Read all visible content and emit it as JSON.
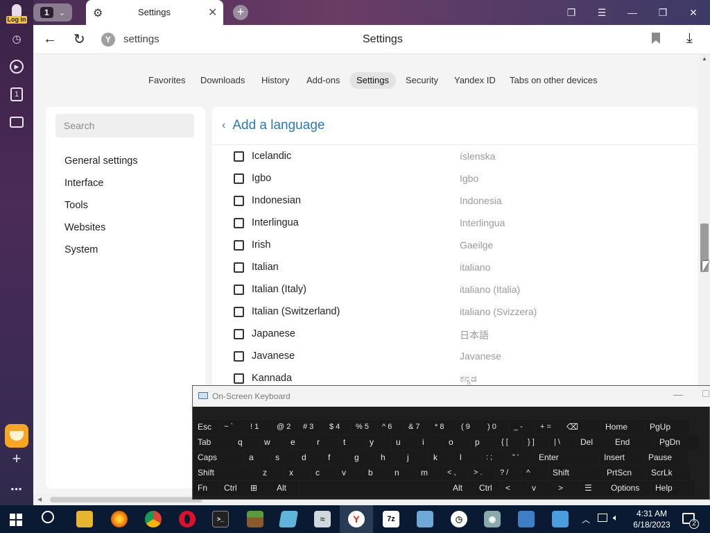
{
  "browser": {
    "login_label": "Log in",
    "tab_count": "1",
    "active_tab_title": "Settings",
    "address_text": "settings",
    "page_header": "Settings"
  },
  "nav_tabs": [
    {
      "label": "Favorites"
    },
    {
      "label": "Downloads"
    },
    {
      "label": "History"
    },
    {
      "label": "Add-ons"
    },
    {
      "label": "Settings",
      "active": true
    },
    {
      "label": "Security"
    },
    {
      "label": "Yandex ID"
    },
    {
      "label": "Tabs on other devices"
    }
  ],
  "settings_menu": {
    "search_placeholder": "Search",
    "items": [
      "General settings",
      "Interface",
      "Tools",
      "Websites",
      "System"
    ]
  },
  "language_panel": {
    "title": "Add a language",
    "languages": [
      {
        "name": "Icelandic",
        "native": "íslenska",
        "checked": false
      },
      {
        "name": "Igbo",
        "native": "Igbo",
        "checked": false
      },
      {
        "name": "Indonesian",
        "native": "Indonesia",
        "checked": false
      },
      {
        "name": "Interlingua",
        "native": "Interlingua",
        "checked": false
      },
      {
        "name": "Irish",
        "native": "Gaeilge",
        "checked": false
      },
      {
        "name": "Italian",
        "native": "italiano",
        "checked": false
      },
      {
        "name": "Italian (Italy)",
        "native": "italiano (Italia)",
        "checked": false
      },
      {
        "name": "Italian (Switzerland)",
        "native": "italiano (Svizzera)",
        "checked": false
      },
      {
        "name": "Japanese",
        "native": "日本語",
        "checked": false
      },
      {
        "name": "Javanese",
        "native": "Javanese",
        "checked": false
      },
      {
        "name": "Kannada",
        "native": "ಕನ್ನಡ",
        "checked": false
      }
    ]
  },
  "on_screen_keyboard": {
    "title": "On-Screen Keyboard",
    "rows": [
      [
        "Esc",
        "~ `",
        "! 1",
        "@ 2",
        "# 3",
        "$ 4",
        "% 5",
        "^ 6",
        "& 7",
        "* 8",
        "( 9",
        ") 0",
        "_ -",
        "+ =",
        "⌫",
        "Home",
        "PgUp"
      ],
      [
        "Tab",
        "q",
        "w",
        "e",
        "r",
        "t",
        "y",
        "u",
        "i",
        "o",
        "p",
        "{ [",
        "} ]",
        "| \\",
        "Del",
        "End",
        "PgDn"
      ],
      [
        "Caps",
        "a",
        "s",
        "d",
        "f",
        "g",
        "h",
        "j",
        "k",
        "l",
        ": ;",
        "\" '",
        "Enter",
        "Insert",
        "Pause"
      ],
      [
        "Shift",
        "z",
        "x",
        "c",
        "v",
        "b",
        "n",
        "m",
        "< ,",
        "> .",
        "? /",
        "^",
        "Shift",
        "PrtScn",
        "ScrLk"
      ],
      [
        "Fn",
        "Ctrl",
        "⊞",
        "Alt",
        "",
        "Alt",
        "Ctrl",
        "<",
        "v",
        ">",
        "☰",
        "Options",
        "Help"
      ]
    ]
  },
  "taskbar": {
    "time": "4:31 AM",
    "date": "6/18/2023",
    "notification_count": "2",
    "apps": [
      "start",
      "search",
      "file-explorer",
      "firefox",
      "chrome",
      "opera",
      "terminal",
      "minecraft",
      "notepad",
      "task-manager",
      "yandex",
      "7zip",
      "control-panel",
      "clock-app",
      "camera",
      "remote-desktop",
      "document-app"
    ]
  },
  "colors": {
    "accent_blue": "#2d78b6",
    "sidebar_purple": "#3a2246",
    "taskbar": "#0a1a33"
  }
}
